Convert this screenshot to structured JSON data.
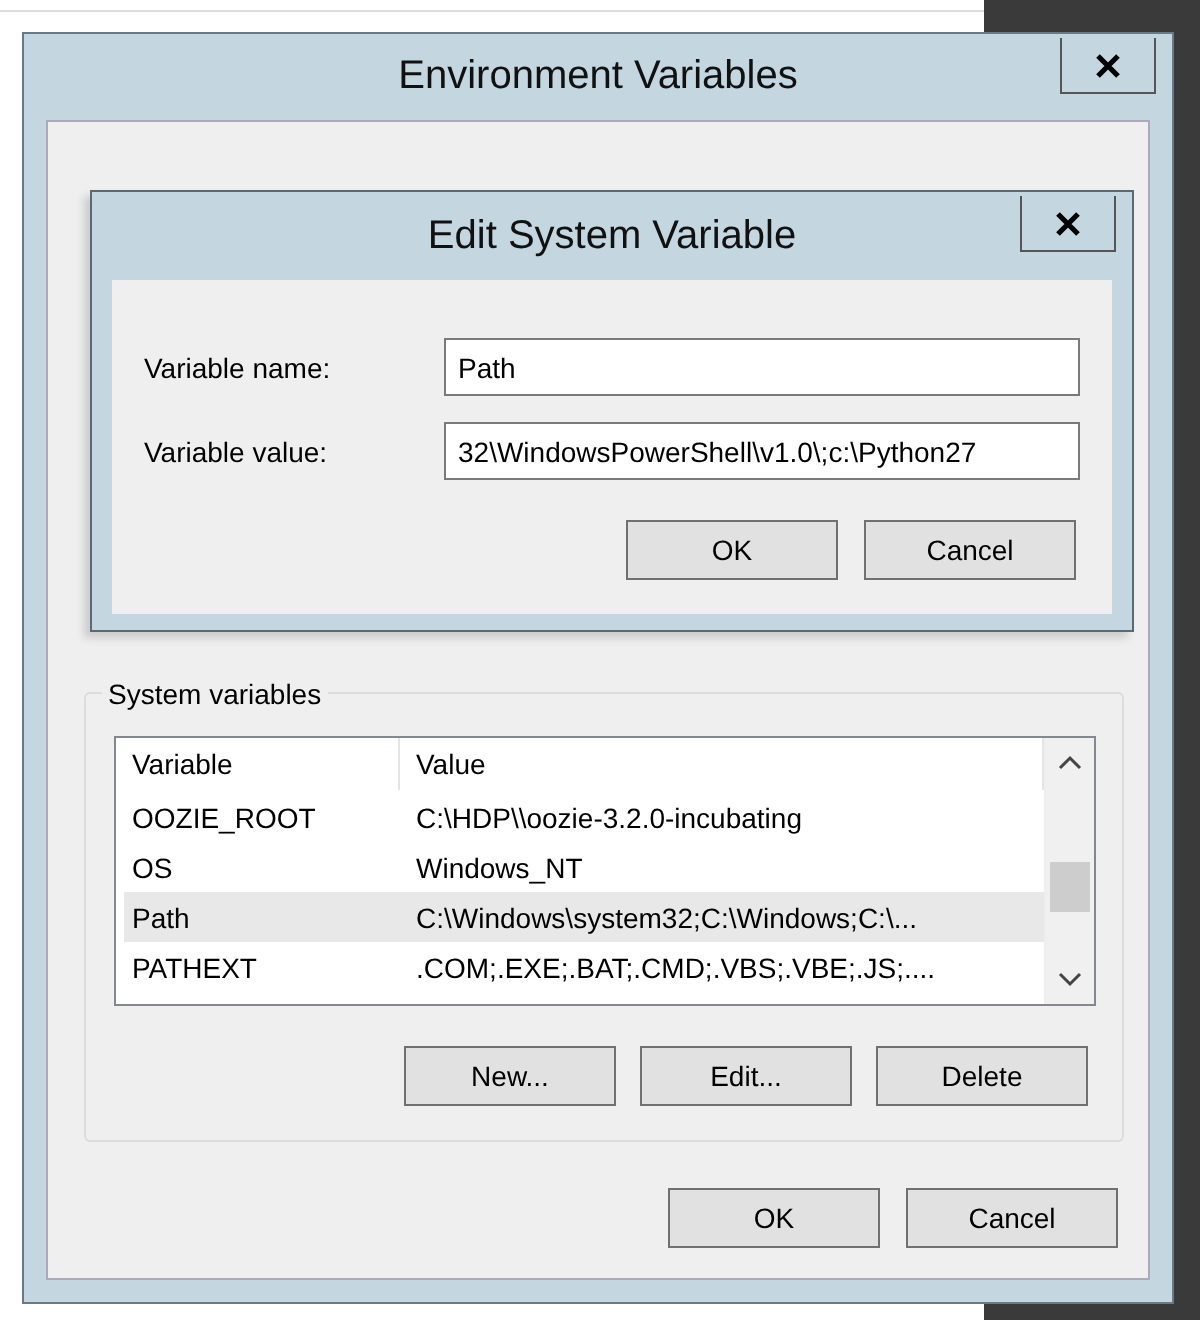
{
  "environment_dialog": {
    "title": "Environment Variables",
    "system_variables": {
      "title": "System variables",
      "columns": [
        "Variable",
        "Value"
      ],
      "rows": [
        {
          "variable": "OOZIE_ROOT",
          "value": "C:\\HDP\\\\oozie-3.2.0-incubating",
          "selected": false
        },
        {
          "variable": "OS",
          "value": "Windows_NT",
          "selected": false
        },
        {
          "variable": "Path",
          "value": "C:\\Windows\\system32;C:\\Windows;C:\\...",
          "selected": true
        },
        {
          "variable": "PATHEXT",
          "value": ".COM;.EXE;.BAT;.CMD;.VBS;.VBE;.JS;....",
          "selected": false
        }
      ],
      "buttons": [
        "New...",
        "Edit...",
        "Delete"
      ]
    },
    "buttons": [
      "OK",
      "Cancel"
    ]
  },
  "edit_dialog": {
    "title": "Edit System Variable",
    "fields": [
      {
        "label": "Variable name:",
        "value": "Path"
      },
      {
        "label": "Variable value:",
        "value": "32\\WindowsPowerShell\\v1.0\\;c:\\Python27"
      }
    ],
    "buttons": [
      "OK",
      "Cancel"
    ]
  }
}
